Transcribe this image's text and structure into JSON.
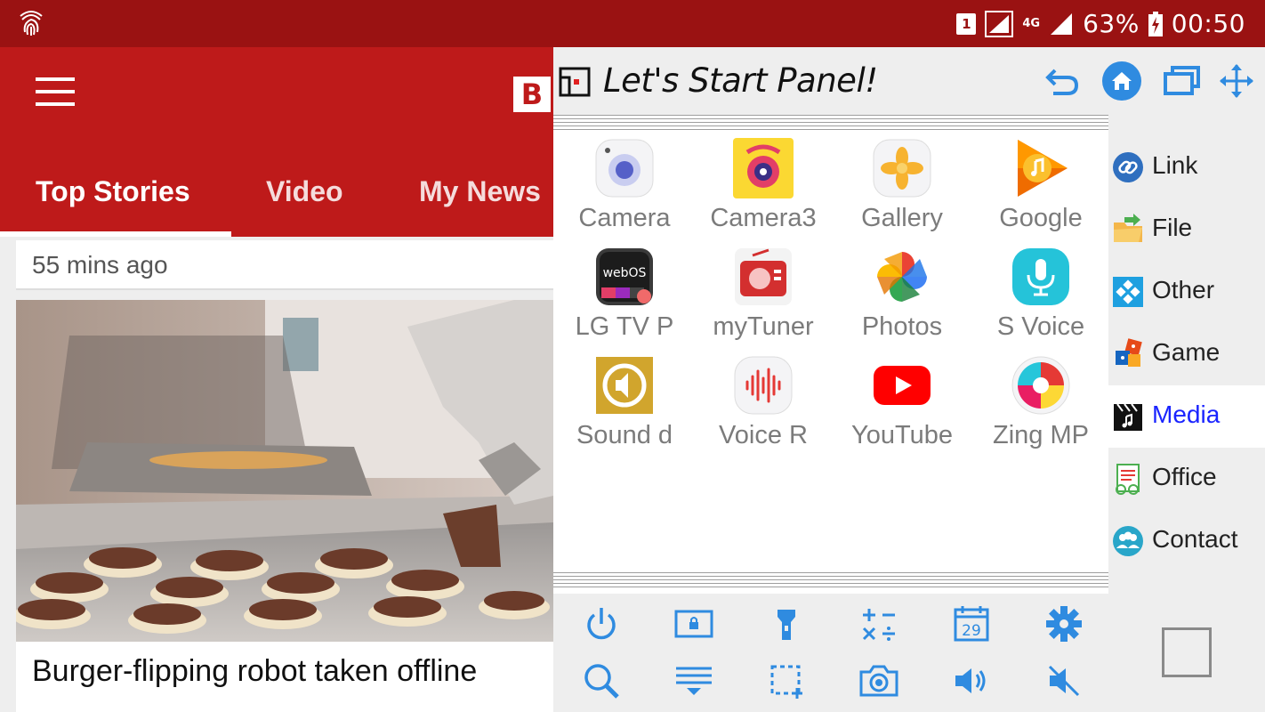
{
  "status_bar": {
    "sim_slot": "1",
    "network": "4G",
    "battery": "63%",
    "time": "00:50"
  },
  "news_app": {
    "logo_letter": "B",
    "tabs": [
      {
        "label": "Top Stories",
        "active": true
      },
      {
        "label": "Video",
        "active": false
      },
      {
        "label": "My News",
        "active": false
      }
    ],
    "timestamp": "55 mins ago",
    "headline": "Burger-flipping robot taken offline"
  },
  "panel": {
    "title": "Let's Start Panel!",
    "toolbar": [
      {
        "name": "undo-icon"
      },
      {
        "name": "home-icon"
      },
      {
        "name": "windows-icon"
      },
      {
        "name": "move-icon"
      }
    ],
    "apps": [
      {
        "label": "Camera",
        "icon": "camera-icon"
      },
      {
        "label": "Camera3",
        "icon": "camera3-icon"
      },
      {
        "label": "Gallery",
        "icon": "gallery-icon"
      },
      {
        "label": "Google",
        "icon": "google-play-music-icon"
      },
      {
        "label": "LG TV P",
        "icon": "lg-tv-plus-icon"
      },
      {
        "label": "myTuner",
        "icon": "mytuner-radio-icon"
      },
      {
        "label": "Photos",
        "icon": "google-photos-icon"
      },
      {
        "label": "S Voice",
        "icon": "s-voice-icon"
      },
      {
        "label": "Sound d",
        "icon": "sound-detector-icon"
      },
      {
        "label": "Voice R",
        "icon": "voice-recorder-icon"
      },
      {
        "label": "YouTube",
        "icon": "youtube-icon"
      },
      {
        "label": "Zing MP",
        "icon": "zing-mp3-icon"
      }
    ],
    "categories": [
      {
        "label": "Link",
        "icon": "link-icon",
        "active": false
      },
      {
        "label": "File",
        "icon": "folder-icon",
        "active": false
      },
      {
        "label": "Other",
        "icon": "other-icon",
        "active": false
      },
      {
        "label": "Game",
        "icon": "game-icon",
        "active": false
      },
      {
        "label": "Media",
        "icon": "clapperboard-icon",
        "active": true
      },
      {
        "label": "Office",
        "icon": "office-icon",
        "active": false
      },
      {
        "label": "Contact",
        "icon": "contacts-icon",
        "active": false
      }
    ],
    "quick_actions": [
      "power-icon",
      "lock-screen-icon",
      "flashlight-icon",
      "calculator-icon",
      "calendar-icon",
      "settings-gear-icon",
      "search-icon",
      "notification-shade-icon",
      "screenshot-region-icon",
      "camera-capture-icon",
      "volume-icon",
      "mute-icon"
    ],
    "calendar_day": "29",
    "accent_color": "#2f8be0"
  }
}
